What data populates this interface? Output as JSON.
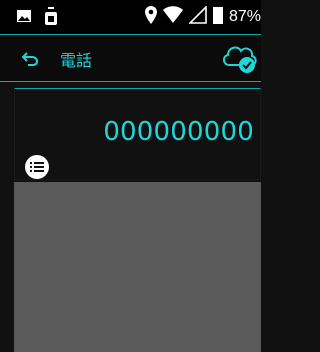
{
  "status_bar": {
    "icons": [
      "image-icon",
      "download-icon",
      "location-icon",
      "wifi-icon",
      "signal-icon",
      "battery-icon"
    ],
    "battery_percent": "87%"
  },
  "app_bar": {
    "title": "電話",
    "back_icon": "back-arrow-icon",
    "sync_icon": "cloud-check-icon"
  },
  "phone_card": {
    "number": "000000000",
    "menu_icon": "list-menu-icon"
  },
  "colors": {
    "accent": "#1fd7d7",
    "app_bg": "#111111",
    "panel_bg": "#5a5a5a",
    "divider": "#16a6a6"
  }
}
